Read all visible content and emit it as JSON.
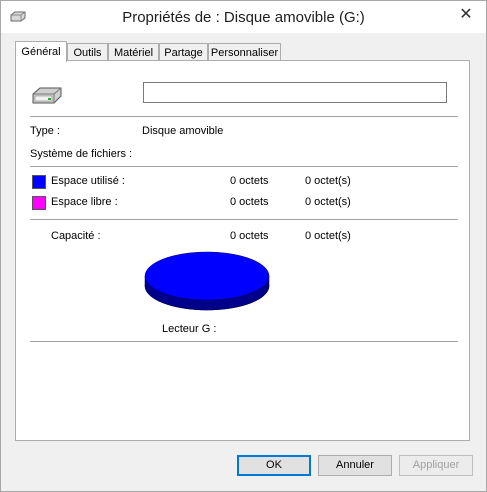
{
  "window": {
    "title": "Propriétés de : Disque amovible (G:)",
    "close_glyph": "✕"
  },
  "tabs": [
    {
      "label": "Général",
      "active": true
    },
    {
      "label": "Outils",
      "active": false
    },
    {
      "label": "Matériel",
      "active": false
    },
    {
      "label": "Partage",
      "active": false
    },
    {
      "label": "Personnaliser",
      "active": false
    }
  ],
  "general": {
    "volume_label_value": "",
    "type_label": "Type :",
    "type_value": "Disque amovible",
    "filesystem_label": "Système de fichiers :",
    "filesystem_value": "",
    "used": {
      "label": "Espace utilisé :",
      "bytes": "0 octets",
      "size": "0 octet(s)",
      "color": "#0000ff"
    },
    "free": {
      "label": "Espace libre :",
      "bytes": "0 octets",
      "size": "0 octet(s)",
      "color": "#ff00ff"
    },
    "capacity": {
      "label": "Capacité :",
      "bytes": "0 octets",
      "size": "0 octet(s)"
    },
    "drive_label": "Lecteur G :"
  },
  "buttons": {
    "ok": "OK",
    "cancel": "Annuler",
    "apply": "Appliquer"
  },
  "icons": {
    "title": "drive-icon",
    "drive": "removable-drive-icon",
    "close": "close-icon"
  }
}
